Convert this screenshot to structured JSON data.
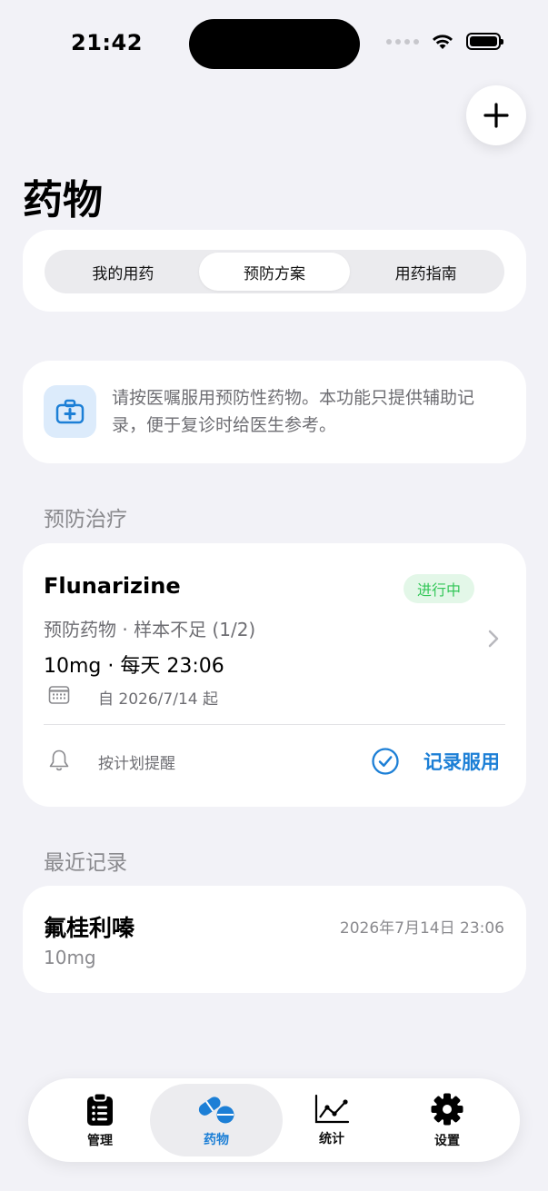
{
  "status_bar": {
    "time": "21:42"
  },
  "header": {
    "title": "药物"
  },
  "segments": [
    {
      "label": "我的用药"
    },
    {
      "label": "预防方案"
    },
    {
      "label": "用药指南"
    }
  ],
  "selected_segment": "预防方案",
  "notice": {
    "text": "请按医嘱服用预防性药物。本功能只提供辅助记录，便于复诊时给医生参考。"
  },
  "prevention": {
    "section_title": "预防治疗",
    "plan": {
      "name": "Flunarizine",
      "status": "进行中",
      "subtitle": "预防药物 · 样本不足 (1/2)",
      "dose_schedule": "10mg · 每天 23:06",
      "since": "自 2026/7/14 起",
      "reminder": "按计划提醒",
      "record_label": "记录服用"
    }
  },
  "recent": {
    "section_title": "最近记录",
    "records": [
      {
        "name": "氟桂利嗪",
        "time": "2026年7月14日 23:06",
        "dose": "10mg"
      }
    ]
  },
  "tabbar": {
    "items": [
      {
        "label": "管理",
        "icon": "clipboard-icon"
      },
      {
        "label": "药物",
        "icon": "pills-icon"
      },
      {
        "label": "统计",
        "icon": "chart-icon"
      },
      {
        "label": "设置",
        "icon": "gear-icon"
      }
    ],
    "selected": "药物"
  },
  "colors": {
    "accent": "#1c7fd6",
    "status_green": "#34c759",
    "background": "#f2f2f7"
  }
}
